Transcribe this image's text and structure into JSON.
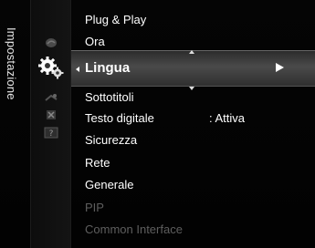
{
  "sidebar": {
    "label": "Impostazione"
  },
  "menu": {
    "items": [
      {
        "label": "Plug & Play"
      },
      {
        "label": "Ora"
      },
      {
        "label": "Lingua"
      },
      {
        "label": "Sottotitoli"
      },
      {
        "label": "Testo digitale",
        "value": ": Attiva"
      },
      {
        "label": "Sicurezza"
      },
      {
        "label": "Rete"
      },
      {
        "label": "Generale"
      },
      {
        "label": "PIP"
      },
      {
        "label": "Common Interface"
      }
    ]
  },
  "icons": [
    "picture-icon",
    "settings-gears-icon",
    "input-icon",
    "application-icon",
    "support-icon"
  ],
  "colors": {
    "highlight": "#4a4a4a",
    "disabled_text": "#5e5e5e"
  }
}
